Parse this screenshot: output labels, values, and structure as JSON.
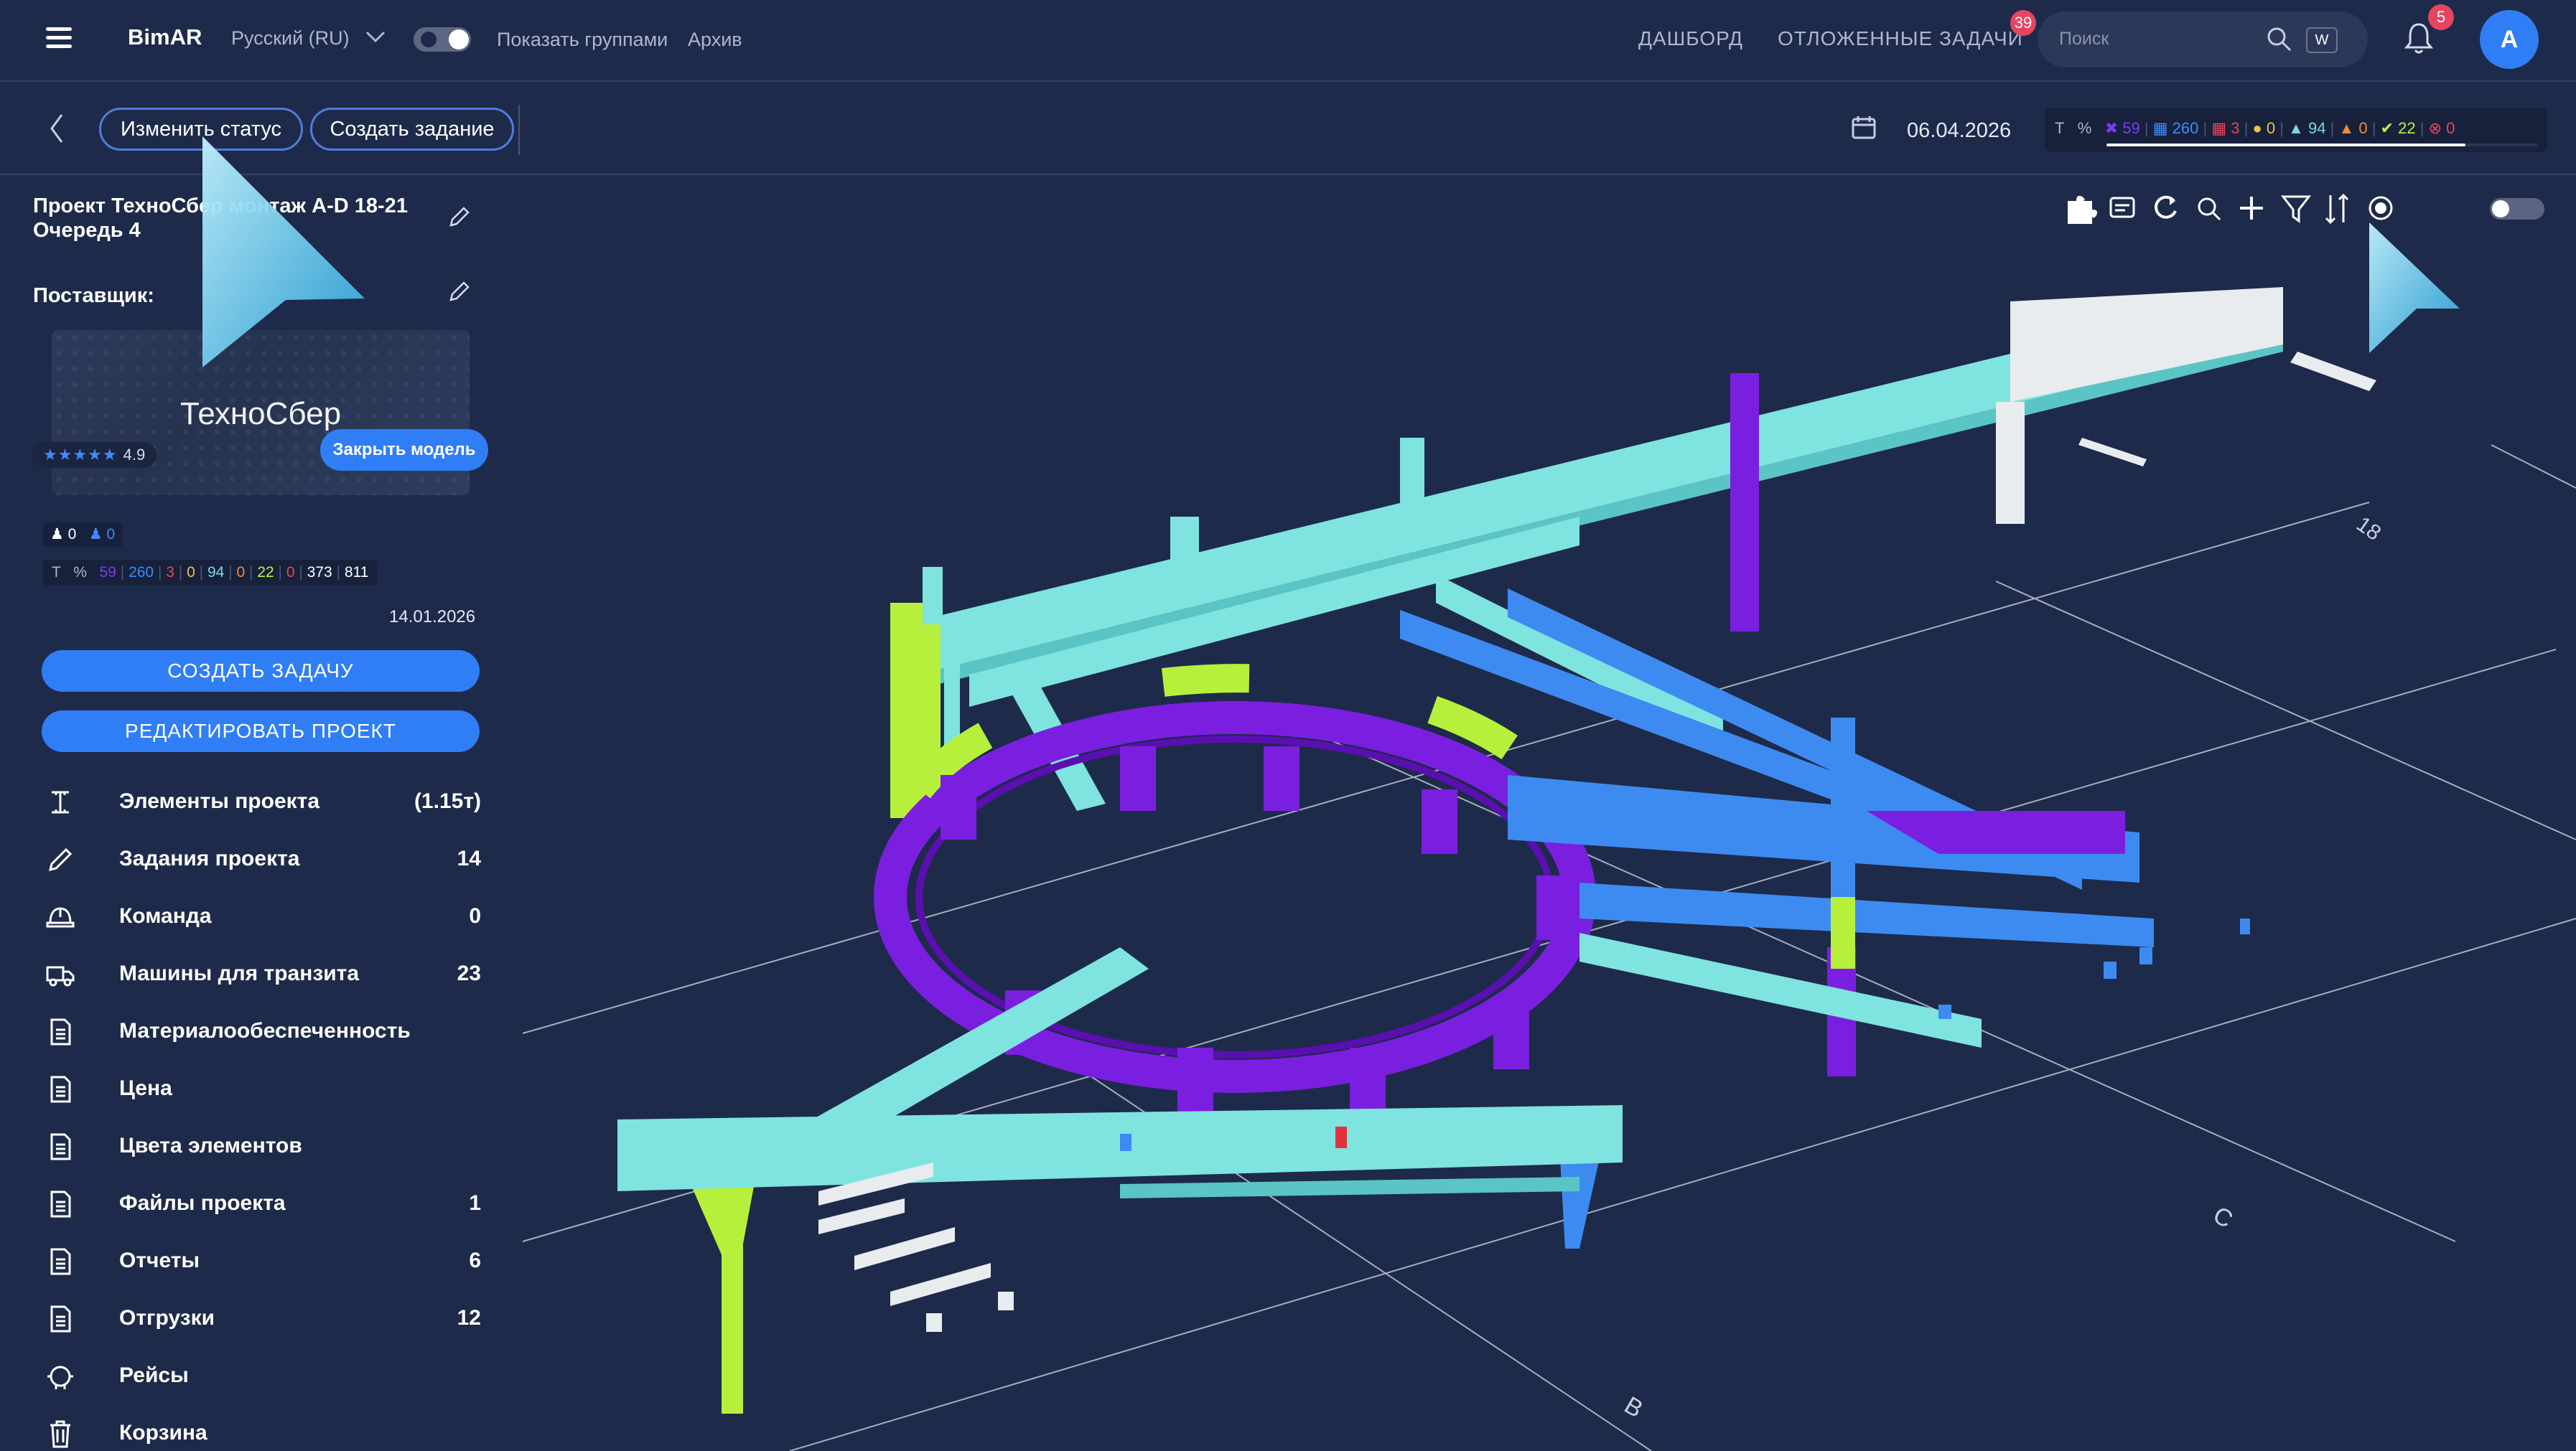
{
  "header": {
    "brand": "BimAR",
    "language": "Русский (RU)",
    "show_groups": "Показать группами",
    "archive": "Архив",
    "dashboard": "ДАШБОРД",
    "postponed": "ОТЛОЖЕННЫЕ ЗАДАЧИ",
    "postponed_count": "39",
    "search_placeholder": "Поиск",
    "search_shortcut": "W",
    "notifications_count": "5",
    "avatar_letter": "A"
  },
  "subbar": {
    "change_status": "Изменить статус",
    "create_task": "Создать задание",
    "date": "06.04.2026",
    "stats": [
      {
        "icon": "x-icon",
        "value": "59",
        "color": "#7b3cf0"
      },
      {
        "icon": "grid-icon",
        "value": "260",
        "color": "#3d8bff"
      },
      {
        "icon": "grid-icon",
        "value": "3",
        "color": "#e64560"
      },
      {
        "icon": "chat-icon",
        "value": "0",
        "color": "#f2c04a"
      },
      {
        "icon": "helmet-icon",
        "value": "94",
        "color": "#7ed7e0"
      },
      {
        "icon": "helmet-icon",
        "value": "0",
        "color": "#f08a3c"
      },
      {
        "icon": "check-icon",
        "value": "22",
        "color": "#b8f34a"
      },
      {
        "icon": "x-circle-icon",
        "value": "0",
        "color": "#e64560"
      }
    ],
    "stat_prefix_t": "T",
    "stat_prefix_pct": "%"
  },
  "sidebar": {
    "project_title_line1": "Проект ТехноСбер монтаж A-D 18-21",
    "project_title_line2": "Очередь 4",
    "supplier_label": "Поставщик:",
    "supplier_name": "ТехноСбер",
    "rating_stars": "★★★★★",
    "rating_value": "4.9",
    "close_model": "Закрыть модель",
    "people_a": "0",
    "people_b": "0",
    "mini_stats": {
      "t": "T",
      "pct": "%",
      "v1": "59",
      "v2": "260",
      "v3": "3",
      "v4": "0",
      "v5": "94",
      "v6": "0",
      "v7": "22",
      "v8": "0",
      "v9": "373",
      "v10": "811"
    },
    "date": "14.01.2026",
    "create_task_btn": "СОЗДАТЬ ЗАДАЧУ",
    "edit_project_btn": "РЕДАКТИРОВАТЬ ПРОЕКТ",
    "menu": [
      {
        "label": "Элементы проекта",
        "count": "(1.15т)",
        "icon": "beam-icon"
      },
      {
        "label": "Задания проекта",
        "count": "14",
        "icon": "pencil-icon"
      },
      {
        "label": "Команда",
        "count": "0",
        "icon": "helmet-icon"
      },
      {
        "label": "Машины для транзита",
        "count": "23",
        "icon": "truck-icon"
      },
      {
        "label": "Материалообеспеченность",
        "count": "",
        "icon": "document-icon"
      },
      {
        "label": "Цена",
        "count": "",
        "icon": "document-icon"
      },
      {
        "label": "Цвета элементов",
        "count": "",
        "icon": "document-icon"
      },
      {
        "label": "Файлы проекта",
        "count": "1",
        "icon": "document-icon"
      },
      {
        "label": "Отчеты",
        "count": "6",
        "icon": "document-icon"
      },
      {
        "label": "Отгрузки",
        "count": "12",
        "icon": "document-icon"
      },
      {
        "label": "Рейсы",
        "count": "",
        "icon": "route-icon"
      },
      {
        "label": "Корзина",
        "count": "",
        "icon": "trash-icon"
      }
    ]
  },
  "viewport": {
    "grid_labels": [
      "18",
      "C",
      "B"
    ],
    "colors": {
      "cyan": "#7fe3e0",
      "blue": "#3d8bf0",
      "purple": "#7a1fe0",
      "lime": "#b7f03c",
      "white": "#e8ecef",
      "red": "#e0323c"
    }
  }
}
